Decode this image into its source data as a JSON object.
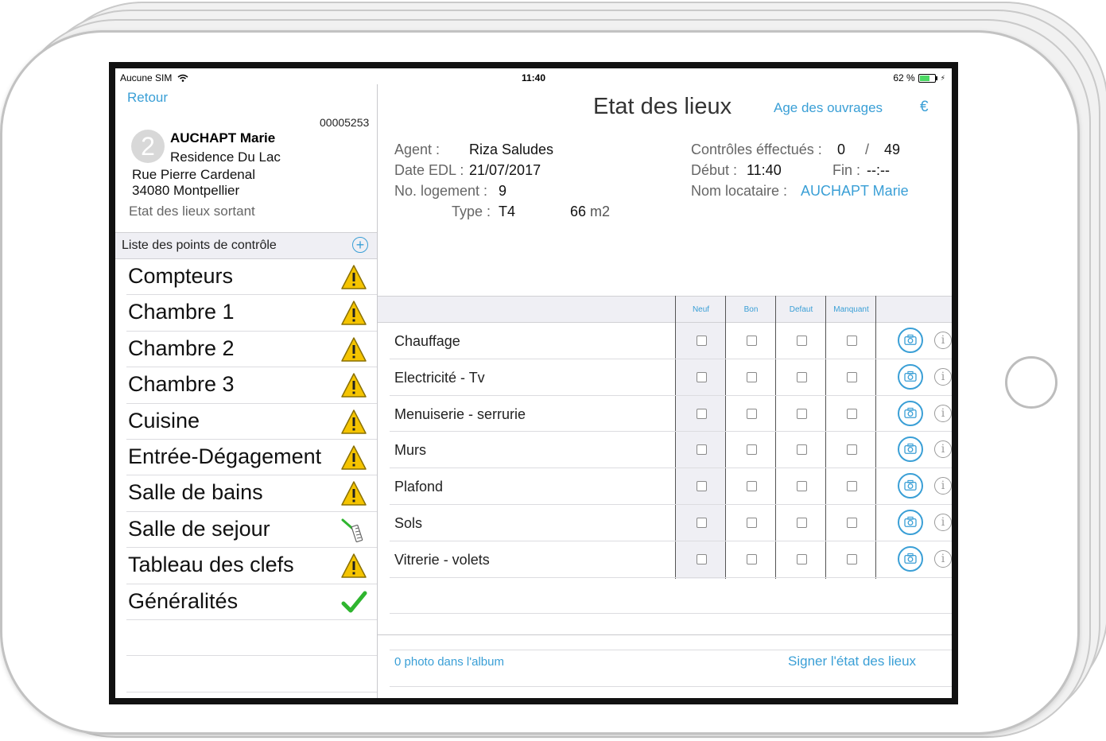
{
  "status_bar": {
    "carrier": "Aucune SIM",
    "time": "11:40",
    "battery": "62 %"
  },
  "sidebar": {
    "back_label": "Retour",
    "record_number": "00005253",
    "avatar_number": "2",
    "tenant_name": "AUCHAPT Marie",
    "residence": "Residence Du Lac",
    "street": "Rue Pierre Cardenal",
    "city": "34080 Montpellier",
    "edl_type": "Etat des lieux sortant",
    "list_title": "Liste des points de contrôle",
    "rooms": [
      {
        "name": "Compteurs",
        "status": "warning"
      },
      {
        "name": "Chambre 1",
        "status": "warning"
      },
      {
        "name": "Chambre 2",
        "status": "warning"
      },
      {
        "name": "Chambre 3",
        "status": "warning"
      },
      {
        "name": "Cuisine",
        "status": "warning"
      },
      {
        "name": "Entrée-Dégagement",
        "status": "warning"
      },
      {
        "name": "Salle de bains",
        "status": "warning"
      },
      {
        "name": "Salle de sejour",
        "status": "in-progress"
      },
      {
        "name": "Tableau des clefs",
        "status": "warning"
      },
      {
        "name": "Généralités",
        "status": "done"
      }
    ]
  },
  "header": {
    "title": "Etat des lieux",
    "age_link": "Age des ouvrages",
    "euro_link": "€"
  },
  "info": {
    "agent_label": "Agent :",
    "agent_value": "Riza Saludes",
    "date_label": "Date EDL :",
    "date_value": "21/07/2017",
    "logement_label": "No. logement :",
    "logement_value": "9",
    "type_label": "Type :",
    "type_value": "T4",
    "surface_value": "66",
    "surface_unit": "m2",
    "controls_label": "Contrôles éffectués :",
    "controls_done": "0",
    "controls_sep": "/",
    "controls_total": "49",
    "debut_label": "Début :",
    "debut_value": "11:40",
    "fin_label": "Fin :",
    "fin_value": "--:--",
    "locataire_label": "Nom locataire :",
    "locataire_value": "AUCHAPT Marie"
  },
  "columns": [
    "Neuf",
    "Bon",
    "Defaut",
    "Manquant"
  ],
  "items": [
    {
      "label": "Chauffage"
    },
    {
      "label": "Electricité - Tv"
    },
    {
      "label": "Menuiserie - serrurie"
    },
    {
      "label": "Murs"
    },
    {
      "label": "Plafond"
    },
    {
      "label": "Sols"
    },
    {
      "label": "Vitrerie - volets"
    }
  ],
  "footer": {
    "photos": "0 photo dans l'album",
    "sign": "Signer l'état des lieux"
  },
  "colors": {
    "accent": "#3a9fd6",
    "warning": "#f5c400",
    "done": "#2fb52f"
  }
}
